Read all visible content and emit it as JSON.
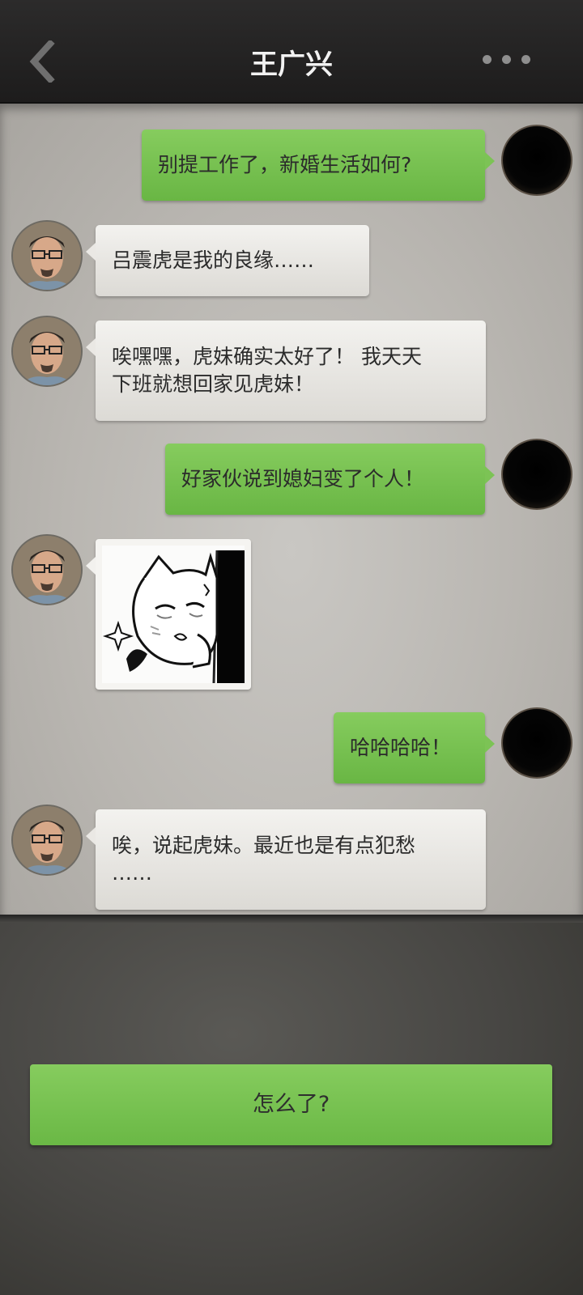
{
  "header": {
    "title": "王广兴",
    "back_icon": "chevron-left-icon",
    "more_icon": "more-dots-icon"
  },
  "messages": [
    {
      "side": "right",
      "type": "text",
      "text": "别提工作了，新婚生活如何?"
    },
    {
      "side": "left",
      "type": "text",
      "text": "吕震虎是我的良缘……"
    },
    {
      "side": "left",
      "type": "text",
      "lines": [
        "唉嘿嘿，虎妹确实太好了！ 我天天",
        "下班就想回家见虎妹！"
      ]
    },
    {
      "side": "right",
      "type": "text",
      "text": "好家伙说到媳妇变了个人！"
    },
    {
      "side": "left",
      "type": "sticker",
      "sticker": "crying-cat-girl-sticker"
    },
    {
      "side": "right",
      "type": "text",
      "text": "哈哈哈哈！"
    },
    {
      "side": "left",
      "type": "text",
      "lines": [
        "唉，说起虎妹。最近也是有点犯愁",
        "……"
      ]
    }
  ],
  "reply": {
    "label": "怎么了?"
  },
  "colors": {
    "header_bg": "#1f1e1e",
    "bubble_right": "#77c150",
    "bubble_left": "#e8e7e3",
    "chat_bg": "#bcb9b4",
    "bottom_bg": "#454440"
  }
}
